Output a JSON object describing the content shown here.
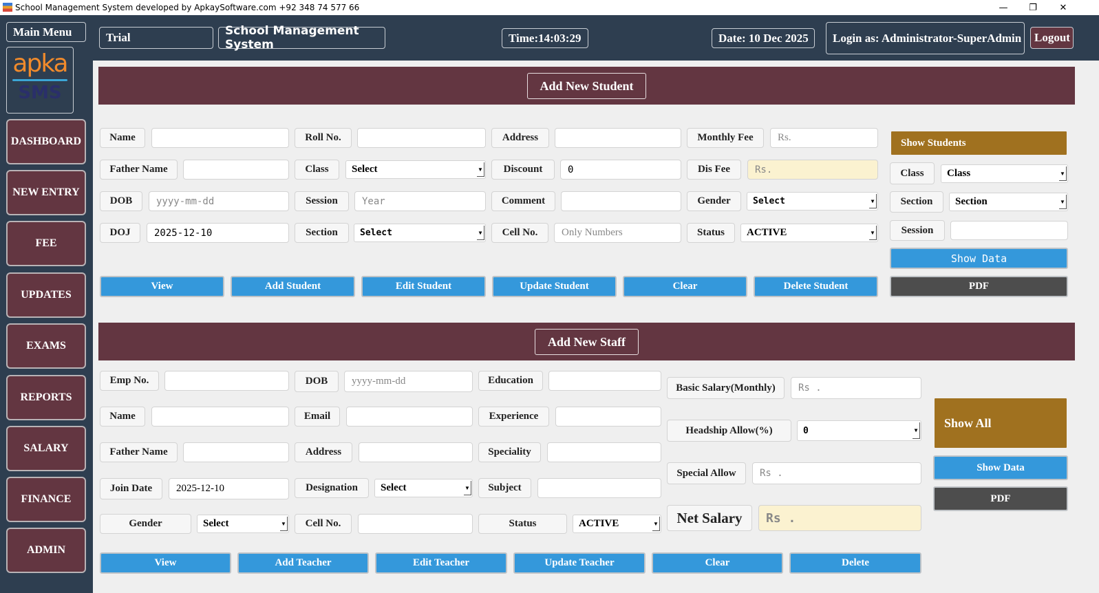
{
  "window": {
    "title": "School Management System developed by ApkaySoftware.com +92 348 74 577 66",
    "minimize": "—",
    "restore": "❐",
    "close": "✕"
  },
  "header": {
    "trial": "Trial",
    "app_name": "School Management System",
    "time": "Time:14:03:29",
    "date": "Date: 10 Dec 2025",
    "login": "Login as: Administrator-SuperAdmin",
    "logout": "Logout"
  },
  "sidebar": {
    "main_menu": "Main Menu",
    "logo_top": "apka",
    "logo_bottom": "SMS",
    "items": [
      "DASHBOARD",
      "NEW ENTRY",
      "FEE",
      "UPDATES",
      "EXAMS",
      "REPORTS",
      "SALARY",
      "FINANCE",
      "ADMIN"
    ]
  },
  "student": {
    "title": "Add New Student",
    "fields": [
      {
        "label": "Name",
        "value": ""
      },
      {
        "label": "Roll No.",
        "value": ""
      },
      {
        "label": "Address",
        "value": ""
      },
      {
        "label": "Monthly Fee",
        "placeholder": "Rs."
      },
      {
        "label": "Father Name",
        "value": ""
      },
      {
        "label": "Class",
        "select": "Select"
      },
      {
        "label": "Discount",
        "value": "0"
      },
      {
        "label": "Dis Fee",
        "placeholder": "Rs."
      },
      {
        "label": "DOB",
        "placeholder": "yyyy-mm-dd"
      },
      {
        "label": "Session",
        "placeholder": "Year"
      },
      {
        "label": "Comment",
        "value": ""
      },
      {
        "label": "Gender",
        "select": "Select"
      },
      {
        "label": "DOJ",
        "value": "2025-12-10"
      },
      {
        "label": "Section",
        "select": "Select"
      },
      {
        "label": "Cell No.",
        "placeholder": "Only Numbers"
      },
      {
        "label": "Status",
        "select": "ACTIVE"
      }
    ],
    "buttons": [
      "View",
      "Add Student",
      "Edit Student",
      "Update Student",
      "Clear",
      "Delete Student"
    ],
    "side": {
      "show_students": "Show Students",
      "class_label": "Class",
      "class_select": "Class",
      "section_label": "Section",
      "section_select": "Section",
      "session_label": "Session",
      "session_value": "",
      "show_data": "Show Data",
      "pdf": "PDF"
    }
  },
  "staff": {
    "title": "Add New Staff",
    "fields": [
      {
        "label": "Emp No.",
        "value": ""
      },
      {
        "label": "DOB",
        "placeholder": "yyyy-mm-dd"
      },
      {
        "label": "Education",
        "value": ""
      },
      {
        "label": "Name",
        "value": ""
      },
      {
        "label": "Email",
        "value": ""
      },
      {
        "label": "Experience",
        "value": ""
      },
      {
        "label": "Father Name",
        "value": ""
      },
      {
        "label": "Address",
        "value": ""
      },
      {
        "label": "Speciality",
        "value": ""
      },
      {
        "label": "Join Date",
        "value": "2025-12-10"
      },
      {
        "label": "Designation",
        "select": "Select"
      },
      {
        "label": "Subject",
        "value": ""
      },
      {
        "label": "Gender",
        "select": "Select"
      },
      {
        "label": "Cell No.",
        "value": ""
      },
      {
        "label": "Status",
        "select": "ACTIVE"
      },
      {
        "label": "Basic Salary(Monthly)",
        "placeholder": "Rs ."
      },
      {
        "label": "Headship Allow(%)",
        "select": "0"
      },
      {
        "label": "Special Allow",
        "placeholder": "Rs ."
      },
      {
        "label": "Net Salary",
        "placeholder": "Rs ."
      }
    ],
    "buttons": [
      "View",
      "Add Teacher",
      "Edit Teacher",
      "Update Teacher",
      "Clear",
      "Delete"
    ],
    "side": {
      "show_all": "Show All",
      "show_data": "Show Data",
      "pdf": "PDF"
    }
  },
  "colors": {
    "sidebar": "#2e3e50",
    "maroon": "#633641",
    "blue": "#3498db",
    "gold": "#a0711f",
    "dark": "#4d4d4d",
    "beige": "#fbf2d0"
  }
}
